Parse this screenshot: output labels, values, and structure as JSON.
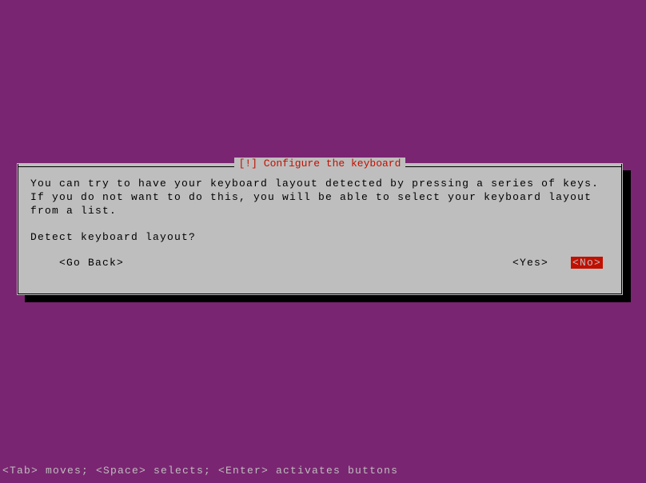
{
  "dialog": {
    "title": "[!] Configure the keyboard",
    "body": "You can try to have your keyboard layout detected by pressing a series of keys. If you do not want to do this, you will be able to select your keyboard layout from a list.",
    "question": "Detect keyboard layout?",
    "buttons": {
      "go_back": "<Go Back>",
      "yes": "<Yes>",
      "no": "<No>"
    }
  },
  "help_bar": "<Tab> moves; <Space> selects; <Enter> activates buttons"
}
